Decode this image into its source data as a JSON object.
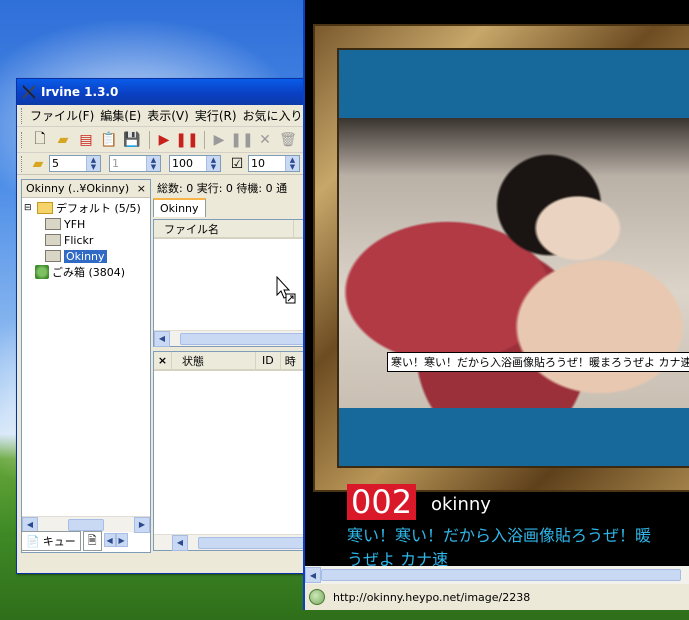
{
  "irvine": {
    "title": "Irvine 1.3.0",
    "menu": [
      "ファイル(F)",
      "編集(E)",
      "表示(V)",
      "実行(R)",
      "お気に入り"
    ],
    "spinners": {
      "a": "5",
      "b": "1",
      "c": "100",
      "d": "10"
    },
    "left_pane_title": "Okinny (..¥Okinny)",
    "tree": [
      {
        "label": "デフォルト (5/5)"
      },
      {
        "label": "YFH"
      },
      {
        "label": "Flickr"
      },
      {
        "label": "Okinny"
      },
      {
        "label": "ごみ箱 (3804)"
      }
    ],
    "stats": "総数: 0  実行: 0  待機: 0  通",
    "tab_label": "Okinny",
    "file_col": "ファイル名",
    "status_cols": [
      "状態",
      "ID",
      "時"
    ],
    "bottom_tab_queue": "キュー",
    "close_label": "×"
  },
  "viewer": {
    "caption_tooltip": "寒い！寒い！だから入浴画像貼ろうぜ！暖まろうぜよ カナ速",
    "number": "002",
    "nick": "okinny",
    "caption_line1": "寒い！寒い！だから入浴画像貼ろうぜ！暖",
    "caption_line2": "うぜよ カナ速",
    "url": "http://okinny.heypo.net/image/2238"
  }
}
